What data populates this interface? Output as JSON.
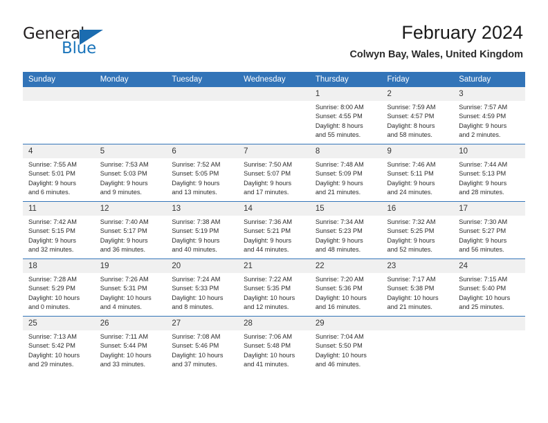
{
  "brand": {
    "name_top": "General",
    "name_bottom": "Blue"
  },
  "header": {
    "title": "February 2024",
    "subtitle": "Colwyn Bay, Wales, United Kingdom"
  },
  "colors": {
    "header_blue": "#3274b8",
    "logo_blue": "#1b75bb",
    "day_strip": "#f0f0f0"
  },
  "weekdays": [
    "Sunday",
    "Monday",
    "Tuesday",
    "Wednesday",
    "Thursday",
    "Friday",
    "Saturday"
  ],
  "days": [
    {
      "num": "",
      "sunrise": "",
      "sunset": "",
      "daylight1": "",
      "daylight2": ""
    },
    {
      "num": "",
      "sunrise": "",
      "sunset": "",
      "daylight1": "",
      "daylight2": ""
    },
    {
      "num": "",
      "sunrise": "",
      "sunset": "",
      "daylight1": "",
      "daylight2": ""
    },
    {
      "num": "",
      "sunrise": "",
      "sunset": "",
      "daylight1": "",
      "daylight2": ""
    },
    {
      "num": "1",
      "sunrise": "Sunrise: 8:00 AM",
      "sunset": "Sunset: 4:55 PM",
      "daylight1": "Daylight: 8 hours",
      "daylight2": "and 55 minutes."
    },
    {
      "num": "2",
      "sunrise": "Sunrise: 7:59 AM",
      "sunset": "Sunset: 4:57 PM",
      "daylight1": "Daylight: 8 hours",
      "daylight2": "and 58 minutes."
    },
    {
      "num": "3",
      "sunrise": "Sunrise: 7:57 AM",
      "sunset": "Sunset: 4:59 PM",
      "daylight1": "Daylight: 9 hours",
      "daylight2": "and 2 minutes."
    },
    {
      "num": "4",
      "sunrise": "Sunrise: 7:55 AM",
      "sunset": "Sunset: 5:01 PM",
      "daylight1": "Daylight: 9 hours",
      "daylight2": "and 6 minutes."
    },
    {
      "num": "5",
      "sunrise": "Sunrise: 7:53 AM",
      "sunset": "Sunset: 5:03 PM",
      "daylight1": "Daylight: 9 hours",
      "daylight2": "and 9 minutes."
    },
    {
      "num": "6",
      "sunrise": "Sunrise: 7:52 AM",
      "sunset": "Sunset: 5:05 PM",
      "daylight1": "Daylight: 9 hours",
      "daylight2": "and 13 minutes."
    },
    {
      "num": "7",
      "sunrise": "Sunrise: 7:50 AM",
      "sunset": "Sunset: 5:07 PM",
      "daylight1": "Daylight: 9 hours",
      "daylight2": "and 17 minutes."
    },
    {
      "num": "8",
      "sunrise": "Sunrise: 7:48 AM",
      "sunset": "Sunset: 5:09 PM",
      "daylight1": "Daylight: 9 hours",
      "daylight2": "and 21 minutes."
    },
    {
      "num": "9",
      "sunrise": "Sunrise: 7:46 AM",
      "sunset": "Sunset: 5:11 PM",
      "daylight1": "Daylight: 9 hours",
      "daylight2": "and 24 minutes."
    },
    {
      "num": "10",
      "sunrise": "Sunrise: 7:44 AM",
      "sunset": "Sunset: 5:13 PM",
      "daylight1": "Daylight: 9 hours",
      "daylight2": "and 28 minutes."
    },
    {
      "num": "11",
      "sunrise": "Sunrise: 7:42 AM",
      "sunset": "Sunset: 5:15 PM",
      "daylight1": "Daylight: 9 hours",
      "daylight2": "and 32 minutes."
    },
    {
      "num": "12",
      "sunrise": "Sunrise: 7:40 AM",
      "sunset": "Sunset: 5:17 PM",
      "daylight1": "Daylight: 9 hours",
      "daylight2": "and 36 minutes."
    },
    {
      "num": "13",
      "sunrise": "Sunrise: 7:38 AM",
      "sunset": "Sunset: 5:19 PM",
      "daylight1": "Daylight: 9 hours",
      "daylight2": "and 40 minutes."
    },
    {
      "num": "14",
      "sunrise": "Sunrise: 7:36 AM",
      "sunset": "Sunset: 5:21 PM",
      "daylight1": "Daylight: 9 hours",
      "daylight2": "and 44 minutes."
    },
    {
      "num": "15",
      "sunrise": "Sunrise: 7:34 AM",
      "sunset": "Sunset: 5:23 PM",
      "daylight1": "Daylight: 9 hours",
      "daylight2": "and 48 minutes."
    },
    {
      "num": "16",
      "sunrise": "Sunrise: 7:32 AM",
      "sunset": "Sunset: 5:25 PM",
      "daylight1": "Daylight: 9 hours",
      "daylight2": "and 52 minutes."
    },
    {
      "num": "17",
      "sunrise": "Sunrise: 7:30 AM",
      "sunset": "Sunset: 5:27 PM",
      "daylight1": "Daylight: 9 hours",
      "daylight2": "and 56 minutes."
    },
    {
      "num": "18",
      "sunrise": "Sunrise: 7:28 AM",
      "sunset": "Sunset: 5:29 PM",
      "daylight1": "Daylight: 10 hours",
      "daylight2": "and 0 minutes."
    },
    {
      "num": "19",
      "sunrise": "Sunrise: 7:26 AM",
      "sunset": "Sunset: 5:31 PM",
      "daylight1": "Daylight: 10 hours",
      "daylight2": "and 4 minutes."
    },
    {
      "num": "20",
      "sunrise": "Sunrise: 7:24 AM",
      "sunset": "Sunset: 5:33 PM",
      "daylight1": "Daylight: 10 hours",
      "daylight2": "and 8 minutes."
    },
    {
      "num": "21",
      "sunrise": "Sunrise: 7:22 AM",
      "sunset": "Sunset: 5:35 PM",
      "daylight1": "Daylight: 10 hours",
      "daylight2": "and 12 minutes."
    },
    {
      "num": "22",
      "sunrise": "Sunrise: 7:20 AM",
      "sunset": "Sunset: 5:36 PM",
      "daylight1": "Daylight: 10 hours",
      "daylight2": "and 16 minutes."
    },
    {
      "num": "23",
      "sunrise": "Sunrise: 7:17 AM",
      "sunset": "Sunset: 5:38 PM",
      "daylight1": "Daylight: 10 hours",
      "daylight2": "and 21 minutes."
    },
    {
      "num": "24",
      "sunrise": "Sunrise: 7:15 AM",
      "sunset": "Sunset: 5:40 PM",
      "daylight1": "Daylight: 10 hours",
      "daylight2": "and 25 minutes."
    },
    {
      "num": "25",
      "sunrise": "Sunrise: 7:13 AM",
      "sunset": "Sunset: 5:42 PM",
      "daylight1": "Daylight: 10 hours",
      "daylight2": "and 29 minutes."
    },
    {
      "num": "26",
      "sunrise": "Sunrise: 7:11 AM",
      "sunset": "Sunset: 5:44 PM",
      "daylight1": "Daylight: 10 hours",
      "daylight2": "and 33 minutes."
    },
    {
      "num": "27",
      "sunrise": "Sunrise: 7:08 AM",
      "sunset": "Sunset: 5:46 PM",
      "daylight1": "Daylight: 10 hours",
      "daylight2": "and 37 minutes."
    },
    {
      "num": "28",
      "sunrise": "Sunrise: 7:06 AM",
      "sunset": "Sunset: 5:48 PM",
      "daylight1": "Daylight: 10 hours",
      "daylight2": "and 41 minutes."
    },
    {
      "num": "29",
      "sunrise": "Sunrise: 7:04 AM",
      "sunset": "Sunset: 5:50 PM",
      "daylight1": "Daylight: 10 hours",
      "daylight2": "and 46 minutes."
    },
    {
      "num": "",
      "sunrise": "",
      "sunset": "",
      "daylight1": "",
      "daylight2": ""
    },
    {
      "num": "",
      "sunrise": "",
      "sunset": "",
      "daylight1": "",
      "daylight2": ""
    }
  ]
}
